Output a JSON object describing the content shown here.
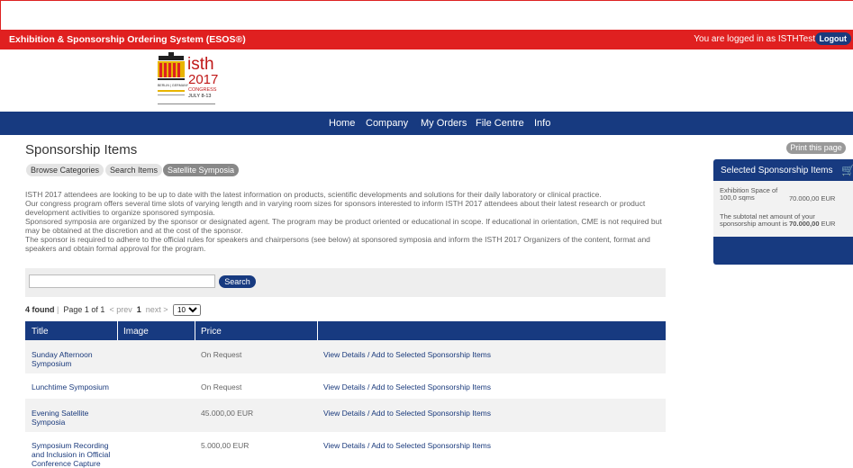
{
  "topbar": {
    "title": "Exhibition & Sponsorship Ordering System (ESOS®)",
    "login_text": "You are logged in as ISTHTest",
    "logout_label": "Logout"
  },
  "logo": {
    "brand": "isth",
    "year": "2017",
    "line1": "CONGRESS",
    "line2": "BERLIN | GERMANY",
    "line3": "JULY 8-13"
  },
  "nav": {
    "items": [
      "Home",
      "Company",
      "My Orders",
      "File Centre",
      "Info"
    ]
  },
  "main": {
    "title": "Sponsorship Items",
    "tabs": [
      {
        "label": "Browse Categories"
      },
      {
        "label": "Search Items"
      },
      {
        "label": "Satellite Symposia"
      }
    ],
    "description": [
      "ISTH 2017 attendees are looking to be up to date with the latest information on products, scientific developments and solutions for their daily laboratory or clinical practice.",
      "Our congress program offers several time slots of varying length and in varying room sizes for sponsors interested to inform ISTH 2017 attendees about their latest research or product development activities to organize sponsored symposia.",
      "Sponsored symposia are organized by the sponsor or designated agent. The program may be product oriented or educational in scope. If educational in orientation, CME is not required but may be obtained at the discretion and at the cost of the sponsor.",
      "The sponsor is required to adhere to the official rules for speakers and chairpersons (see below) at sponsored symposia and inform the ISTH 2017 Organizers of the content, format and speakers and obtain formal approval for the program."
    ],
    "search": {
      "value": "",
      "button": "Search"
    },
    "pager": {
      "found": "4 found",
      "sep": "|",
      "page": "Page 1 of 1",
      "prev": "< prev",
      "current": "1",
      "next": "next >",
      "per_page": "10"
    },
    "table": {
      "headers": [
        "Title",
        "Image",
        "Price",
        ""
      ],
      "rows": [
        {
          "title": "Sunday Afternoon Symposium",
          "price": "On Request",
          "action": "View Details / Add to Selected Sponsorship Items"
        },
        {
          "title": "Lunchtime Symposium",
          "price": "On Request",
          "action": "View Details / Add to Selected Sponsorship Items"
        },
        {
          "title": "Evening Satellite Symposia",
          "price": "45.000,00 EUR",
          "action": "View Details / Add to Selected Sponsorship Items"
        },
        {
          "title": "Symposium Recording and Inclusion in Official Conference Capture",
          "price": "5.000,00 EUR",
          "action": "View Details / Add to Selected Sponsorship Items"
        }
      ]
    }
  },
  "sidebar": {
    "print_label": "Print this page",
    "header": "Selected Sponsorship Items",
    "item_name": "Exhibition Space of 100,0 sqms",
    "item_price": "70.000,00 EUR",
    "subtotal_prefix": "The subtotal net amount of your sponsorship amount is",
    "subtotal_value": "70.000,00",
    "subtotal_currency": "EUR"
  }
}
